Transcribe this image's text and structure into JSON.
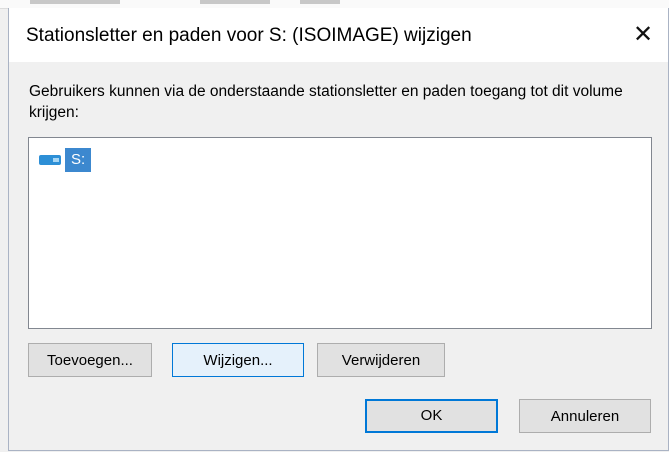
{
  "dialog": {
    "title": "Stationsletter en paden voor S: (ISOIMAGE) wijzigen",
    "close_glyph": "✕",
    "description": "Gebruikers kunnen via de onderstaande stationsletter en paden toegang tot dit volume krijgen:",
    "list": {
      "items": [
        {
          "label": "S:",
          "icon": "drive-icon",
          "selected": true
        }
      ]
    },
    "buttons": {
      "add": "Toevoegen...",
      "change": "Wijzigen...",
      "remove": "Verwijderen",
      "ok": "OK",
      "cancel": "Annuleren"
    }
  },
  "colors": {
    "accent": "#0078d7",
    "selection": "#3c88cf",
    "drive_icon": "#2d8fd6"
  }
}
